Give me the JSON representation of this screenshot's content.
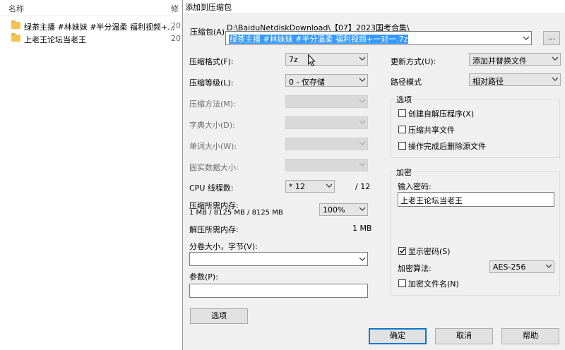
{
  "explorer": {
    "header_name": "名称",
    "header_modified": "修",
    "files": [
      {
        "name": "绿茶主播 #林妹妹 #半分温柔 福利视频+...",
        "date": "20"
      },
      {
        "name": "上老王论坛当老王",
        "date": "20"
      }
    ]
  },
  "dialog": {
    "title": "添加到压缩包",
    "archive_label": "压缩包(A)",
    "archive_path": "D:\\BaiduNetdiskDownload\\【07】2023国考合集\\",
    "archive_name": "绿茶主播 #林妹妹 #半分温柔 福利视频+一对一.7z",
    "browse_label": "...",
    "left": {
      "format_label": "压缩格式(F):",
      "format_value": "7z",
      "level_label": "压缩等级(L):",
      "level_value": "0 - 仅存储",
      "method_label": "压缩方法(M):",
      "dict_label": "字典大小(D):",
      "word_label": "单词大小(W):",
      "solid_label": "固实数据大小:",
      "cpu_label": "CPU 线程数:",
      "cpu_value": "* 12",
      "cpu_max": "/ 12",
      "mem_comp_label": "压缩所需内存:",
      "mem_comp_value": "1 MB / 8125 MB / 8125 MB",
      "mem_percent": "100%",
      "mem_decomp_label": "解压所需内存:",
      "mem_decomp_value": "1 MB",
      "split_label": "分卷大小，字节(V):",
      "params_label": "参数(P):",
      "options_button": "选项"
    },
    "right": {
      "update_label": "更新方式(U):",
      "update_value": "添加并替换文件",
      "pathmode_label": "路径模式",
      "pathmode_value": "相对路径",
      "options_group": "选项",
      "opt_sfx": "创建自解压程序(X)",
      "opt_shared": "压缩共享文件",
      "opt_delete": "操作完成后删除源文件",
      "encrypt_group": "加密",
      "password_label": "输入密码:",
      "password_value": "上老王论坛当老王",
      "show_password": "显示密码(S)",
      "enc_method_label": "加密算法:",
      "enc_method_value": "AES-256",
      "encrypt_names": "加密文件名(N)"
    },
    "buttons": {
      "ok": "确定",
      "cancel": "取消",
      "help": "帮助"
    }
  }
}
